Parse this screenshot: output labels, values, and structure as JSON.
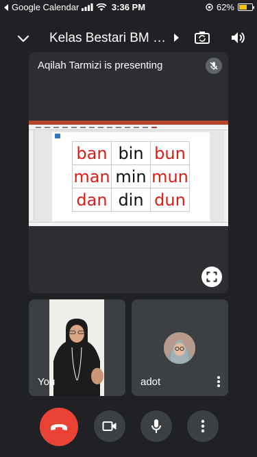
{
  "status_bar": {
    "back_app": "Google Calendar",
    "time": "3:36 PM",
    "battery": "62%",
    "battery_level": 0.62,
    "battery_color": "#f4c20d"
  },
  "header": {
    "title": "Kelas Bestari BM Hu...",
    "icons": [
      "chevron-down-icon",
      "play-icon",
      "switch-camera-icon",
      "speaker-icon"
    ]
  },
  "main_tile": {
    "presenting_label": "Aqilah Tarmizi is presenting",
    "icons": [
      "mic-off-icon",
      "fullscreen-icon"
    ]
  },
  "slide": {
    "grid": [
      [
        {
          "text": "ban",
          "color": "red"
        },
        {
          "text": "bin",
          "color": "black"
        },
        {
          "text": "bun",
          "color": "red"
        }
      ],
      [
        {
          "text": "man",
          "color": "red"
        },
        {
          "text": "min",
          "color": "black"
        },
        {
          "text": "mun",
          "color": "red"
        }
      ],
      [
        {
          "text": "dan",
          "color": "red"
        },
        {
          "text": "din",
          "color": "black"
        },
        {
          "text": "dun",
          "color": "red"
        }
      ]
    ],
    "accent_red": "#d91e18",
    "app_accent": "#b7472a"
  },
  "participants": [
    {
      "name": "You",
      "icons": []
    },
    {
      "name": "adot",
      "icons": [
        "more-vert-icon"
      ]
    }
  ],
  "controls": {
    "end_call_color": "#ea4335",
    "icons": [
      "end-call-icon",
      "camera-icon",
      "microphone-icon",
      "more-vert-icon"
    ]
  }
}
